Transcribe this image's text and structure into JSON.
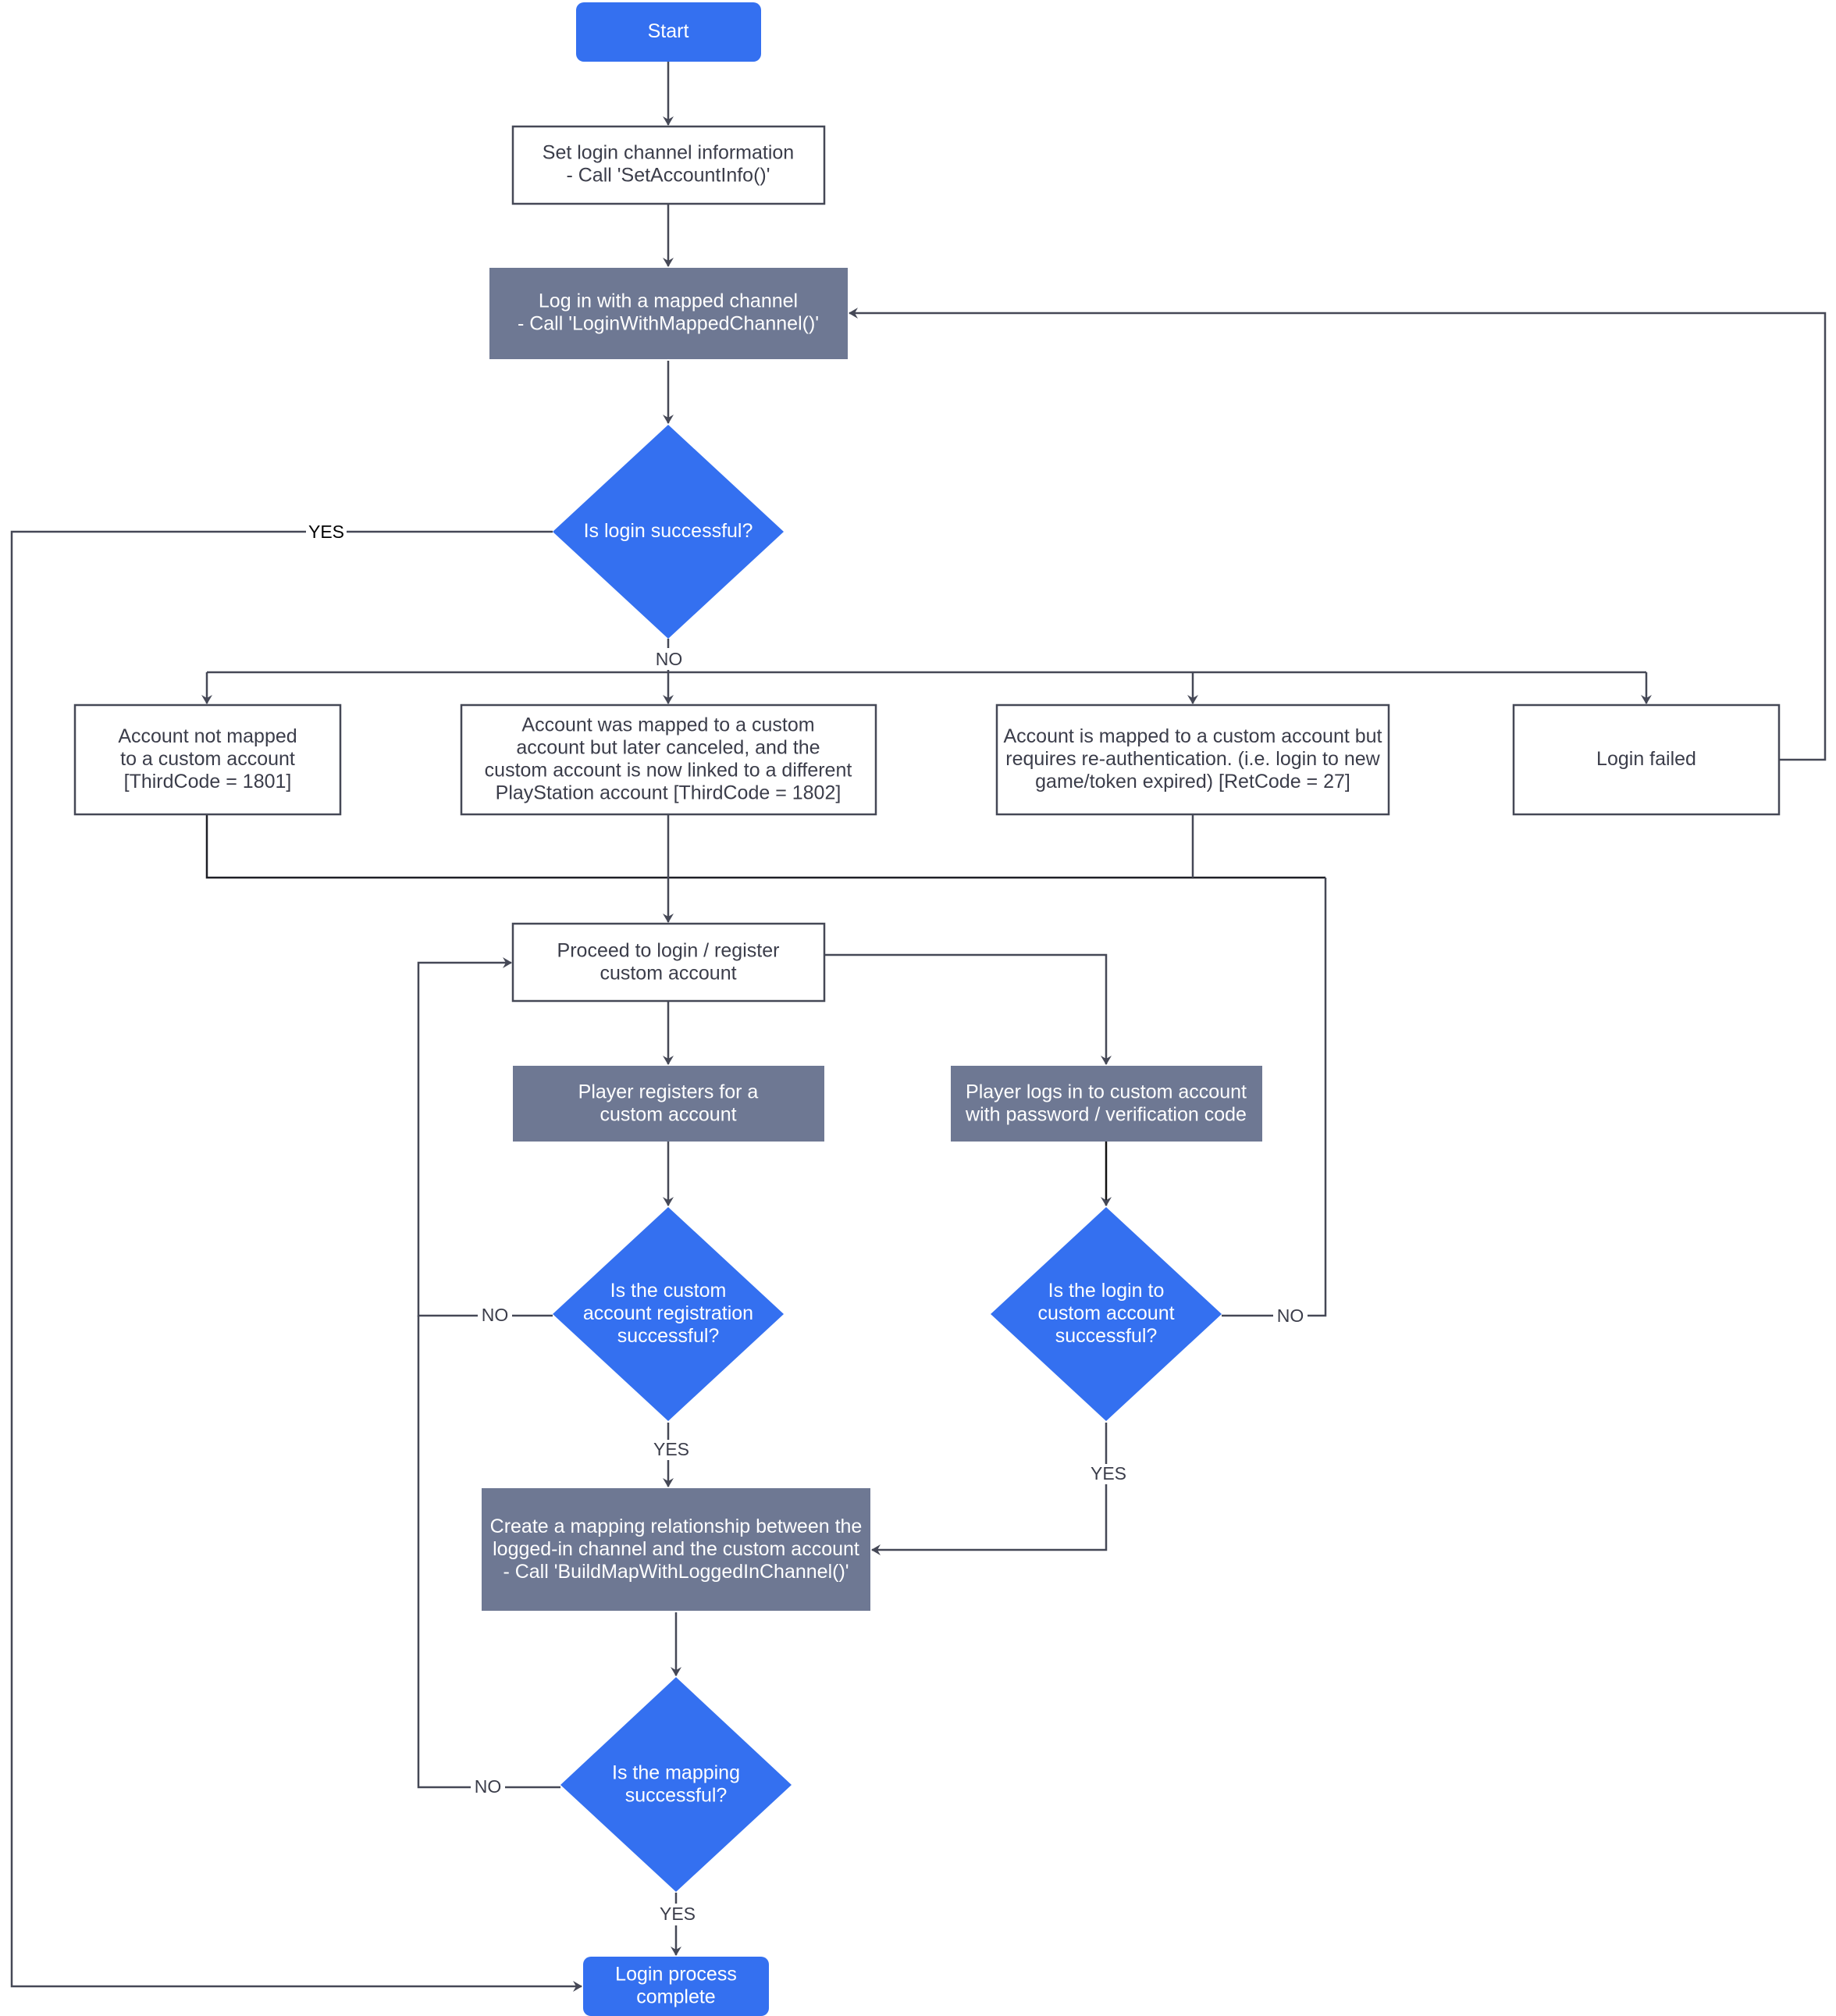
{
  "colors": {
    "terminal": "#3470f0",
    "decision": "#3470f0",
    "api_step": "#6e7893",
    "outline_box_border": "#454856",
    "connector": "#454856",
    "text_dark": "#3b3d4a",
    "text_light": "#ffffff"
  },
  "nodes": {
    "start": {
      "lines": [
        "Start"
      ]
    },
    "set_login_channel": {
      "lines": [
        "Set login channel information",
        "- Call 'SetAccountInfo()'"
      ]
    },
    "login_mapped_channel": {
      "lines": [
        "Log in with a mapped channel",
        "- Call 'LoginWithMappedChannel()'"
      ]
    },
    "is_login_successful": {
      "lines": [
        "Is login successful?"
      ]
    },
    "not_mapped": {
      "lines": [
        "Account not mapped",
        "to a custom account",
        "[ThirdCode = 1801]"
      ]
    },
    "mapped_canceled": {
      "lines": [
        "Account was mapped to a custom",
        "account but later canceled, and the",
        "custom account is now linked to a different",
        "PlayStation account [ThirdCode = 1802]"
      ]
    },
    "needs_reauth": {
      "lines": [
        "Account is mapped to a custom account but",
        "requires re-authentication. (i.e. login to new",
        "game/token expired) [RetCode = 27]"
      ]
    },
    "login_failed": {
      "lines": [
        "Login failed"
      ]
    },
    "proceed_custom": {
      "lines": [
        "Proceed to login / register",
        "custom account"
      ]
    },
    "player_registers": {
      "lines": [
        "Player registers for a",
        "custom account"
      ]
    },
    "player_logs_in": {
      "lines": [
        "Player logs in to custom account",
        "with password / verification code"
      ]
    },
    "is_registration_successful": {
      "lines": [
        "Is the custom",
        "account registration",
        "successful?"
      ]
    },
    "is_custom_login_successful": {
      "lines": [
        "Is the login to",
        "custom account",
        "successful?"
      ]
    },
    "create_mapping": {
      "lines": [
        "Create a mapping relationship between the",
        "logged-in channel and the custom account",
        "- Call 'BuildMapWithLoggedInChannel()'"
      ]
    },
    "is_mapping_successful": {
      "lines": [
        "Is the mapping",
        "successful?"
      ]
    },
    "complete": {
      "lines": [
        "Login process",
        "complete"
      ]
    }
  },
  "edge_labels": {
    "login_yes": "YES",
    "login_no": "NO",
    "registration_no": "NO",
    "registration_yes": "YES",
    "custom_login_no": "NO",
    "custom_login_yes": "YES",
    "mapping_no": "NO",
    "mapping_yes": "YES"
  }
}
